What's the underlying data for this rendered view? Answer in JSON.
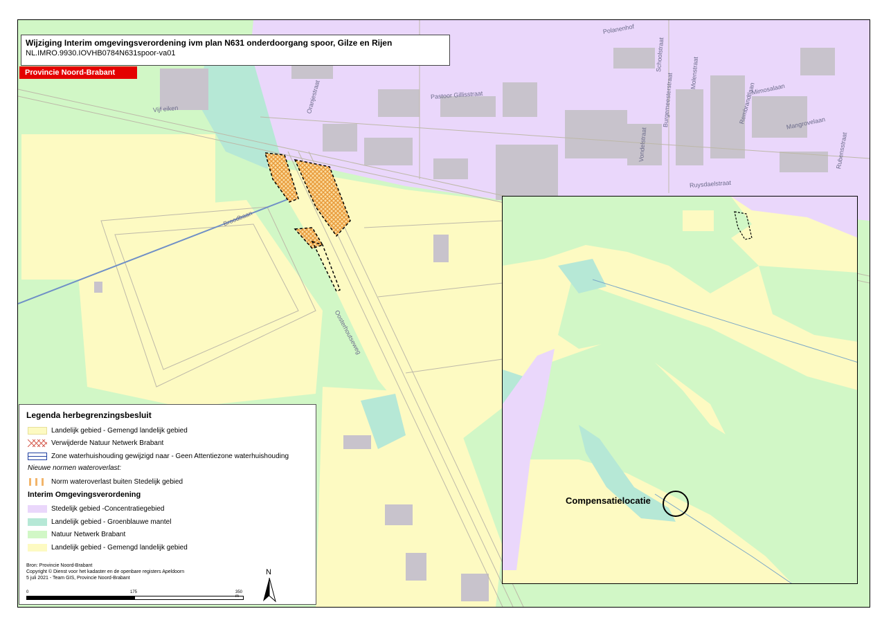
{
  "title": {
    "line1": "Wijziging Interim omgevingsverordening ivm plan N631 onderdoorgang spoor, Gilze en Rijen",
    "line2": "NL.IMRO.9930.IOVHB0784N631spoor-va01"
  },
  "province_badge": "Provincie Noord-Brabant",
  "streets": [
    {
      "label": "Vijf eiken"
    },
    {
      "label": "Broodbaan"
    },
    {
      "label": "Oranjestraat"
    },
    {
      "label": "Pastoor Gillisstraat"
    },
    {
      "label": "Schoolstraat"
    },
    {
      "label": "Burgemeesterstraat"
    },
    {
      "label": "Molenstraat"
    },
    {
      "label": "Vondelstraat"
    },
    {
      "label": "Ruysdaelstraat"
    },
    {
      "label": "Mangrovelaan"
    },
    {
      "label": "Rubensstraat"
    },
    {
      "label": "Polanenhof"
    },
    {
      "label": "Rembrandtlaan"
    },
    {
      "label": "Mimosalaan"
    },
    {
      "label": "Oosterhoutseweg"
    }
  ],
  "legend": {
    "title": "Legenda herbegrenzingsbesluit",
    "herbegrenzing": [
      {
        "label": "Landelijk gebied - Gemengd landelijk gebied",
        "swatch": "#fdfac2"
      },
      {
        "label": "Verwijderde Natuur Netwerk Brabant",
        "swatch": "hatch-red"
      },
      {
        "label": "Zone waterhuishouding gewijzigd naar - Geen Attentiezone waterhuishouding",
        "swatch": "double-blue"
      }
    ],
    "nieuwe_normen_label": "Nieuwe normen wateroverlast:",
    "norm_row": {
      "label": "Norm wateroverlast buiten Stedelijk gebied",
      "swatch": "orange-stripes"
    },
    "interim_title": "Interim Omgevingsverordening",
    "interim": [
      {
        "label": "Stedelijk gebied -Concentratiegebied",
        "swatch": "#ead7fb"
      },
      {
        "label": "Landelijk gebied - Groenblauwe mantel",
        "swatch": "#b6e8d6"
      },
      {
        "label": "Natuur Netwerk Brabant",
        "swatch": "#d1f7c6"
      },
      {
        "label": "Landelijk gebied - Gemengd landelijk gebied",
        "swatch": "#fdfac2"
      }
    ],
    "credits": [
      "Bron: Provincie Noord-Brabant",
      "Copyright © Dienst voor het kadaster en de openbare registers Apeldoorn",
      "5 juli 2021 - Team GIS, Provincie Noord-Brabant"
    ],
    "scale": {
      "labels": [
        "0",
        "175",
        "350 m"
      ]
    },
    "north_label": "N"
  },
  "inset": {
    "label": "Compensatielocatie"
  },
  "colors": {
    "stedelijk": "#ead7fb",
    "groenblauw": "#b6e8d6",
    "natuur": "#d1f7c6",
    "landelijk": "#fdfac2",
    "buildings": "#c8c3cc",
    "water": "#6f8fc6",
    "province_red": "#e40000"
  }
}
